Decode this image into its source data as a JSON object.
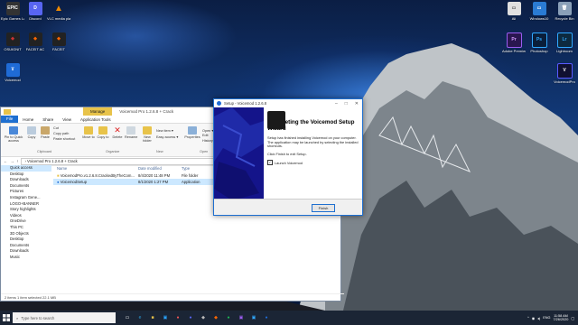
{
  "desktop": {
    "icons_left": [
      {
        "label": "Epic Games Launcher",
        "glyph": "EPIC",
        "color": "#333333"
      },
      {
        "label": "Discord",
        "glyph": "D",
        "color": "#5865f2"
      },
      {
        "label": "VLC media player",
        "glyph": "▲",
        "color": "#f08a00"
      },
      {
        "label": "OSUIGNIT",
        "glyph": "◆",
        "color": "#222222"
      },
      {
        "label": "FACEIT AC",
        "glyph": "◆",
        "color": "#222222"
      },
      {
        "label": "FACEIT",
        "glyph": "◆",
        "color": "#222222"
      },
      {
        "label": "Voicemod",
        "glyph": "\\/",
        "color": "#1f6bd6"
      }
    ],
    "icons_right": [
      {
        "label": "Ali",
        "glyph": "▭",
        "color": "#e0e0e0"
      },
      {
        "label": "Windows10",
        "glyph": "▭",
        "color": "#2a7bd3"
      },
      {
        "label": "Recycle Bin",
        "glyph": "🗑",
        "color": "#8aa0b8"
      },
      {
        "label": "Adobe Premiere",
        "glyph": "Pr",
        "color": "#2a1650"
      },
      {
        "label": "Photoshop",
        "glyph": "Ps",
        "color": "#0a1e3a"
      },
      {
        "label": "Lightroom",
        "glyph": "Lr",
        "color": "#0d2a3f"
      },
      {
        "label": "VoicemodPro",
        "glyph": "V",
        "color": "#101030"
      }
    ]
  },
  "explorer": {
    "context_tab": "Manage",
    "title": "Voicemod Pro 1.2.6.8 + Crack",
    "tabs": [
      "File",
      "Home",
      "Share",
      "View",
      "Application Tools"
    ],
    "ribbon": {
      "pin": "Pin to Quick access",
      "copy": "Copy",
      "paste": "Paste",
      "cut": "Cut",
      "copy_path": "Copy path",
      "paste_shortcut": "Paste shortcut",
      "move_to": "Move to",
      "copy_to": "Copy to",
      "delete": "Delete",
      "rename": "Rename",
      "new_folder": "New folder",
      "new_item": "New item ▾",
      "easy_access": "Easy access ▾",
      "properties": "Properties",
      "open": "Open ▾",
      "edit": "Edit",
      "history": "History",
      "groups": [
        "Clipboard",
        "Organize",
        "New",
        "Open"
      ]
    },
    "address": "› Voicemod Pro 1.2.6.8 + Crack",
    "search_placeholder": "Search Voicemod Pro 1.2...",
    "nav": [
      "Quick access",
      "Desktop",
      "Downloads",
      "Documents",
      "Pictures",
      "Instagram Gene...",
      "LOGO+BANNER",
      "Story highlights",
      "Videos",
      "OneDrive",
      "This PC",
      "3D Objects",
      "Desktop",
      "Documents",
      "Downloads",
      "Music"
    ],
    "columns": [
      "Name",
      "Date modified",
      "Type"
    ],
    "rows": [
      {
        "name": "VoicemodPro.v1.2.6.8.CrackedByTheCom...",
        "date": "8/4/2020 11:48 PM",
        "type": "File folder",
        "icon": "folder"
      },
      {
        "name": "VoicemodSetup",
        "date": "8/1/2020 1:27 PM",
        "type": "Application",
        "icon": "app"
      }
    ],
    "status": "2 items    1 item selected  22.1 MB"
  },
  "setup": {
    "title": "Setup - Voicemod 1.2.6.8",
    "heading": "Completing the Voicemod Setup Wizard",
    "p1": "Setup has finished installing Voicemod on your computer. The application may be launched by selecting the installed shortcuts.",
    "p2": "Click Finish to exit Setup.",
    "checkbox_label": "Launch Voicemod",
    "checkbox_checked": "✓",
    "finish": "Finish"
  },
  "taskbar": {
    "search_placeholder": "Type here to search",
    "time": "11:58 AM",
    "date": "7/26/2020",
    "lang": "ENG"
  }
}
